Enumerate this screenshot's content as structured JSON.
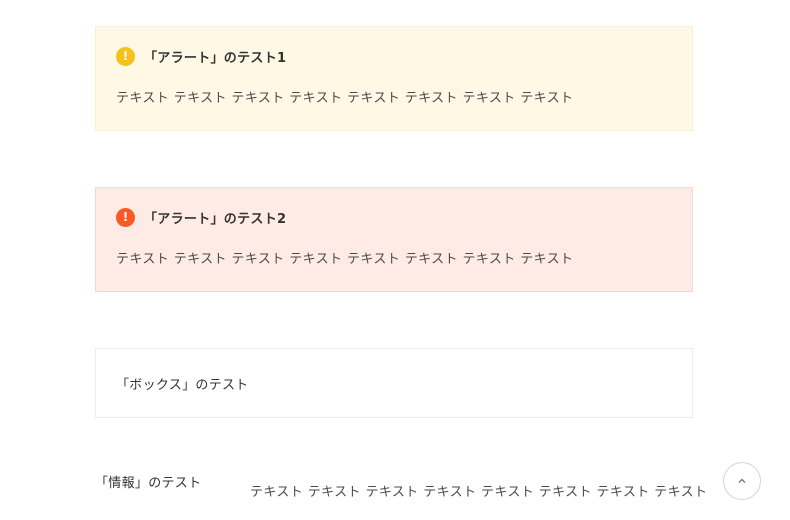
{
  "alerts": [
    {
      "icon": "exclamation-icon",
      "icon_glyph": "!",
      "icon_color": "#f5c21b",
      "background": "#fff8e5",
      "title": "「アラート」のテスト1",
      "body": "テキスト テキスト テキスト テキスト テキスト テキスト テキスト テキスト"
    },
    {
      "icon": "exclamation-icon",
      "icon_glyph": "!",
      "icon_color": "#fb5a22",
      "background": "#ffebe5",
      "title": "「アラート」のテスト2",
      "body": "テキスト テキスト テキスト テキスト テキスト テキスト テキスト テキスト"
    }
  ],
  "box": {
    "title": "「ボックス」のテスト"
  },
  "info": {
    "title": "「情報」のテスト",
    "text": "テキスト テキスト テキスト テキスト テキスト テキスト テキスト テキスト"
  },
  "scroll_top": {
    "icon": "chevron-up-icon"
  }
}
